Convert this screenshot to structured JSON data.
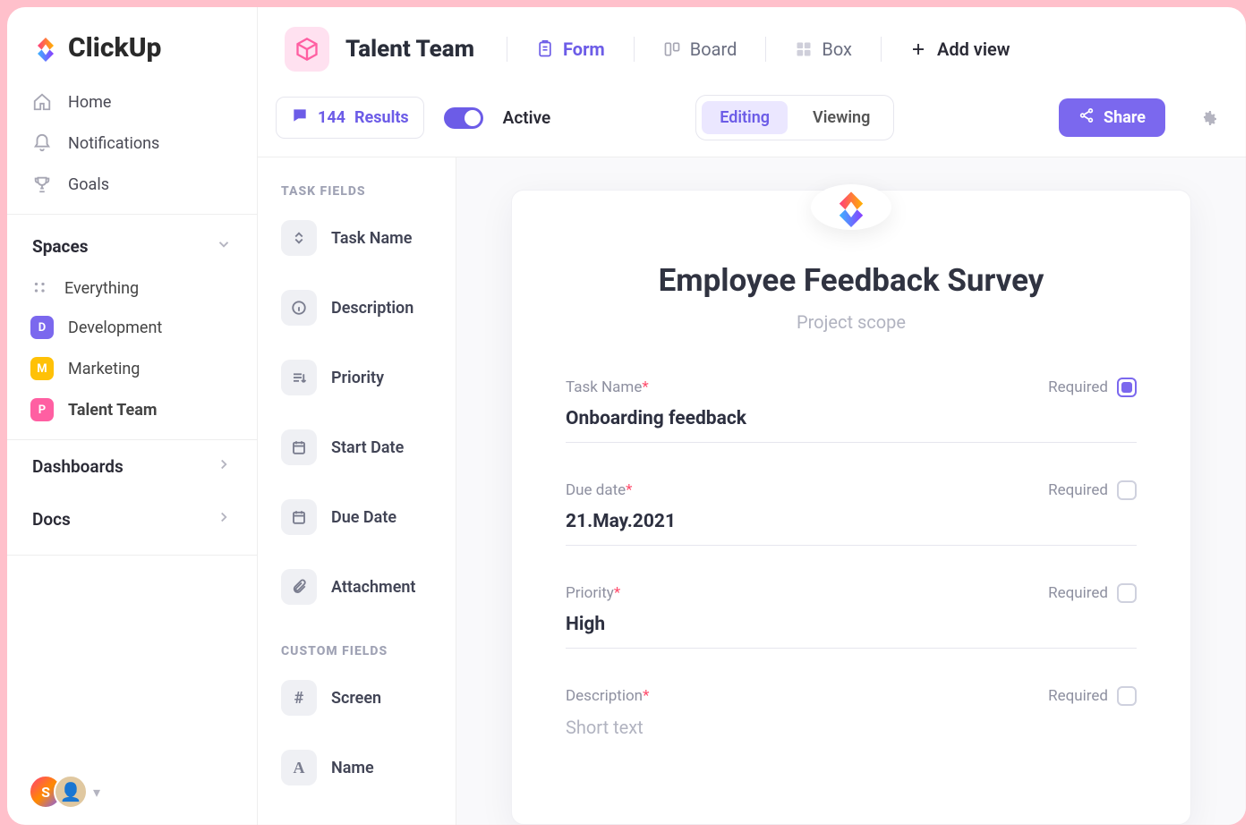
{
  "brand": "ClickUp",
  "nav": {
    "home": "Home",
    "notifications": "Notifications",
    "goals": "Goals"
  },
  "spaces": {
    "heading": "Spaces",
    "everything": "Everything",
    "items": [
      {
        "letter": "D",
        "color": "#7b68ee",
        "label": "Development"
      },
      {
        "letter": "M",
        "color": "#ffc107",
        "label": "Marketing"
      },
      {
        "letter": "P",
        "color": "#ff5fa2",
        "label": "Talent Team"
      }
    ]
  },
  "bottomNav": {
    "dashboards": "Dashboards",
    "docs": "Docs"
  },
  "user": {
    "initial": "S"
  },
  "header": {
    "spaceTitle": "Talent Team",
    "views": {
      "form": "Form",
      "board": "Board",
      "box": "Box",
      "add": "Add view"
    }
  },
  "subbar": {
    "resultsCount": "144",
    "resultsLabel": "Results",
    "activeLabel": "Active",
    "editing": "Editing",
    "viewing": "Viewing",
    "share": "Share"
  },
  "fieldPanel": {
    "taskFieldsHead": "TASK FIELDS",
    "customFieldsHead": "CUSTOM FIELDS",
    "taskFields": [
      "Task Name",
      "Description",
      "Priority",
      "Start Date",
      "Due Date",
      "Attachment"
    ],
    "customFields": [
      "Screen",
      "Name"
    ]
  },
  "form": {
    "title": "Employee Feedback Survey",
    "subtitle": "Project scope",
    "requiredLabel": "Required",
    "fields": [
      {
        "label": "Task Name",
        "value": "Onboarding feedback",
        "required": true,
        "checked": true
      },
      {
        "label": "Due date",
        "value": "21.May.2021",
        "required": true,
        "checked": false
      },
      {
        "label": "Priority",
        "value": "High",
        "required": true,
        "checked": false
      },
      {
        "label": "Description",
        "placeholder": "Short text",
        "required": true,
        "checked": false
      }
    ]
  }
}
